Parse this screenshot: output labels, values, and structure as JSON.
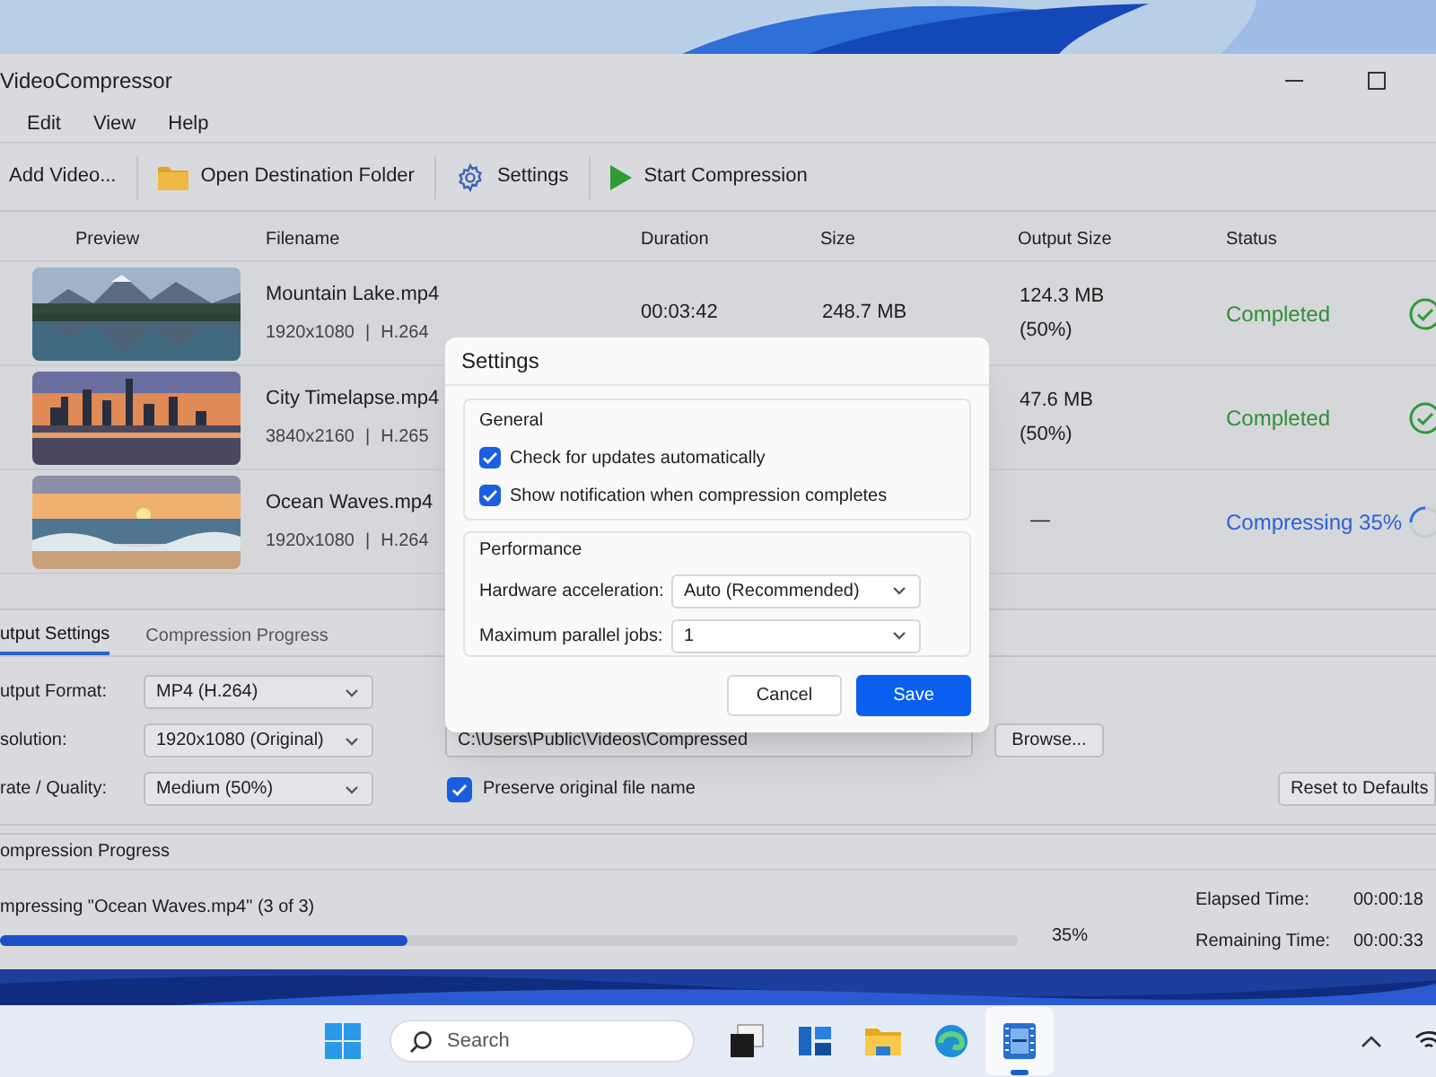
{
  "window": {
    "title": "VideoCompressor"
  },
  "menu": [
    "Edit",
    "View",
    "Help"
  ],
  "toolbar": [
    {
      "kind": "plain",
      "label": "Add Video..."
    },
    {
      "kind": "folder",
      "label": "Open Destination Folder"
    },
    {
      "kind": "gear",
      "label": "Settings"
    },
    {
      "kind": "play",
      "label": "Start Compression"
    }
  ],
  "table": {
    "columns": [
      "Preview",
      "Filename",
      "Duration",
      "Size",
      "Output Size",
      "Status"
    ],
    "rows": [
      {
        "filename": "Mountain Lake.mp4",
        "resolution": "1920x1080",
        "separator": "|",
        "codec": "H.264",
        "duration": "00:03:42",
        "size": "248.7 MB",
        "output_size": "124.3 MB",
        "output_ratio": "(50%)",
        "status": "Completed",
        "kind": "done"
      },
      {
        "filename": "City Timelapse.mp4",
        "resolution": "3840x2160",
        "separator": "|",
        "codec": "H.265",
        "output_size": "47.6 MB",
        "output_ratio": "(50%)",
        "status": "Completed",
        "kind": "done"
      },
      {
        "filename": "Ocean Waves.mp4",
        "resolution": "1920x1080",
        "separator": "|",
        "codec": "H.264",
        "output_size": "—",
        "status": "Compressing 35%",
        "kind": "progress"
      }
    ]
  },
  "tabs": [
    {
      "label": "utput Settings",
      "selected": true
    },
    {
      "label": "Compression Progress",
      "selected": false
    }
  ],
  "output_settings": {
    "fields": [
      {
        "label": "utput Format:",
        "value": "MP4 (H.264)"
      },
      {
        "label": "solution:",
        "value": "1920x1080 (Original)"
      },
      {
        "label": "rate / Quality:",
        "value": "Medium (50%)"
      }
    ],
    "destination": "C:\\Users\\Public\\Videos\\Compressed",
    "browse": "Browse...",
    "preserve": {
      "label": "Preserve original file name",
      "checked": true
    },
    "reset": "Reset to Defaults"
  },
  "progress": {
    "title": "ompression Progress",
    "message": "mpressing \"Ocean Waves.mp4\" (3 of 3)",
    "level": 0.4,
    "percent": "35%",
    "times": [
      {
        "label": "Elapsed Time:",
        "value": "00:00:18"
      },
      {
        "label": "Remaining Time:",
        "value": "00:00:33"
      }
    ]
  },
  "dialog": {
    "title": "Settings",
    "general": {
      "title": "General",
      "options": [
        {
          "label": "Check for updates automatically",
          "checked": true
        },
        {
          "label": "Show notification when compression completes",
          "checked": true
        }
      ]
    },
    "performance": {
      "title": "Performance",
      "fields": [
        {
          "label": "Hardware acceleration:",
          "value": "Auto (Recommended)"
        },
        {
          "label": "Maximum parallel jobs:",
          "value": "1"
        }
      ]
    },
    "buttons": [
      {
        "label": "Cancel",
        "kind": "secondary"
      },
      {
        "label": "Save",
        "kind": "primary"
      }
    ]
  },
  "taskbar": {
    "search": {
      "placeholder": "Search"
    },
    "apps": [
      {
        "kind": "taskview",
        "selected": false
      },
      {
        "kind": "widgets",
        "selected": false
      },
      {
        "kind": "folder",
        "selected": false
      },
      {
        "kind": "browser",
        "selected": false
      },
      {
        "kind": "film",
        "selected": true
      }
    ]
  }
}
